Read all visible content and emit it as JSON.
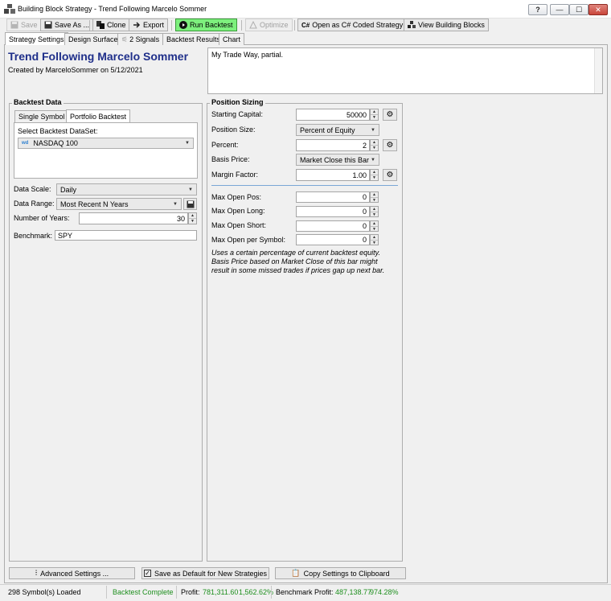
{
  "window": {
    "title": "Building Block Strategy - Trend Following Marcelo Sommer",
    "help": "?",
    "minimize": "—",
    "maximize": "☐",
    "close": "✕"
  },
  "toolbar": {
    "save": "Save",
    "save_as": "Save As ...",
    "clone": "Clone",
    "export": "Export",
    "run_backtest": "Run Backtest",
    "optimize": "Optimize",
    "open_csharp": "Open as C# Coded Strategy",
    "view_blocks": "View Building Blocks"
  },
  "tabs": [
    "Strategy Settings",
    "Design Surface",
    "2 Signals",
    "Backtest Results",
    "Chart"
  ],
  "header": {
    "title": "Trend Following Marcelo Sommer",
    "created": "Created by MarceloSommer on 5/12/2021",
    "description": "My Trade Way, partial."
  },
  "backtest_data": {
    "group_title": "Backtest Data",
    "tab_single": "Single Symbol",
    "tab_portfolio": "Portfolio Backtest",
    "dataset_label": "Select Backtest DataSet:",
    "dataset_badge": "wd",
    "dataset_value": "NASDAQ 100",
    "data_scale_label": "Data Scale:",
    "data_scale_value": "Daily",
    "data_range_label": "Data Range:",
    "data_range_value": "Most Recent N Years",
    "years_label": "Number of Years:",
    "years_value": "30",
    "benchmark_label": "Benchmark:",
    "benchmark_value": "SPY"
  },
  "position_sizing": {
    "group_title": "Position Sizing",
    "starting_capital_label": "Starting Capital:",
    "starting_capital_value": "50000",
    "position_size_label": "Position Size:",
    "position_size_value": "Percent of Equity",
    "percent_label": "Percent:",
    "percent_value": "2",
    "basis_price_label": "Basis Price:",
    "basis_price_value": "Market Close this Bar",
    "margin_factor_label": "Margin Factor:",
    "margin_factor_value": "1.00",
    "max_open_pos_label": "Max Open Pos:",
    "max_open_pos_value": "0",
    "max_open_long_label": "Max Open Long:",
    "max_open_long_value": "0",
    "max_open_short_label": "Max Open Short:",
    "max_open_short_value": "0",
    "max_open_symbol_label": "Max Open per Symbol:",
    "max_open_symbol_value": "0",
    "note": "Uses a certain percentage of current backtest equity. Basis Price based on Market Close of this bar might result in some missed trades if prices gap up next bar."
  },
  "bottom_buttons": {
    "advanced": "Advanced Settings ...",
    "save_default": "Save as Default for New Strategies",
    "copy_clipboard": "Copy Settings to Clipboard"
  },
  "status": {
    "symbols_loaded": "298 Symbol(s) Loaded",
    "backtest_state": "Backtest Complete",
    "profit_label": "Profit:",
    "profit_value": "781,311.60",
    "profit_pct": "1,562.62%",
    "benchmark_label": "Benchmark Profit:",
    "benchmark_value": "487,138.77",
    "benchmark_pct": "974.28%"
  },
  "colors": {
    "title_blue": "#1f2f8a",
    "run_green": "#7df07d",
    "status_green": "#1e8f1e",
    "close_red": "#c9463b"
  }
}
